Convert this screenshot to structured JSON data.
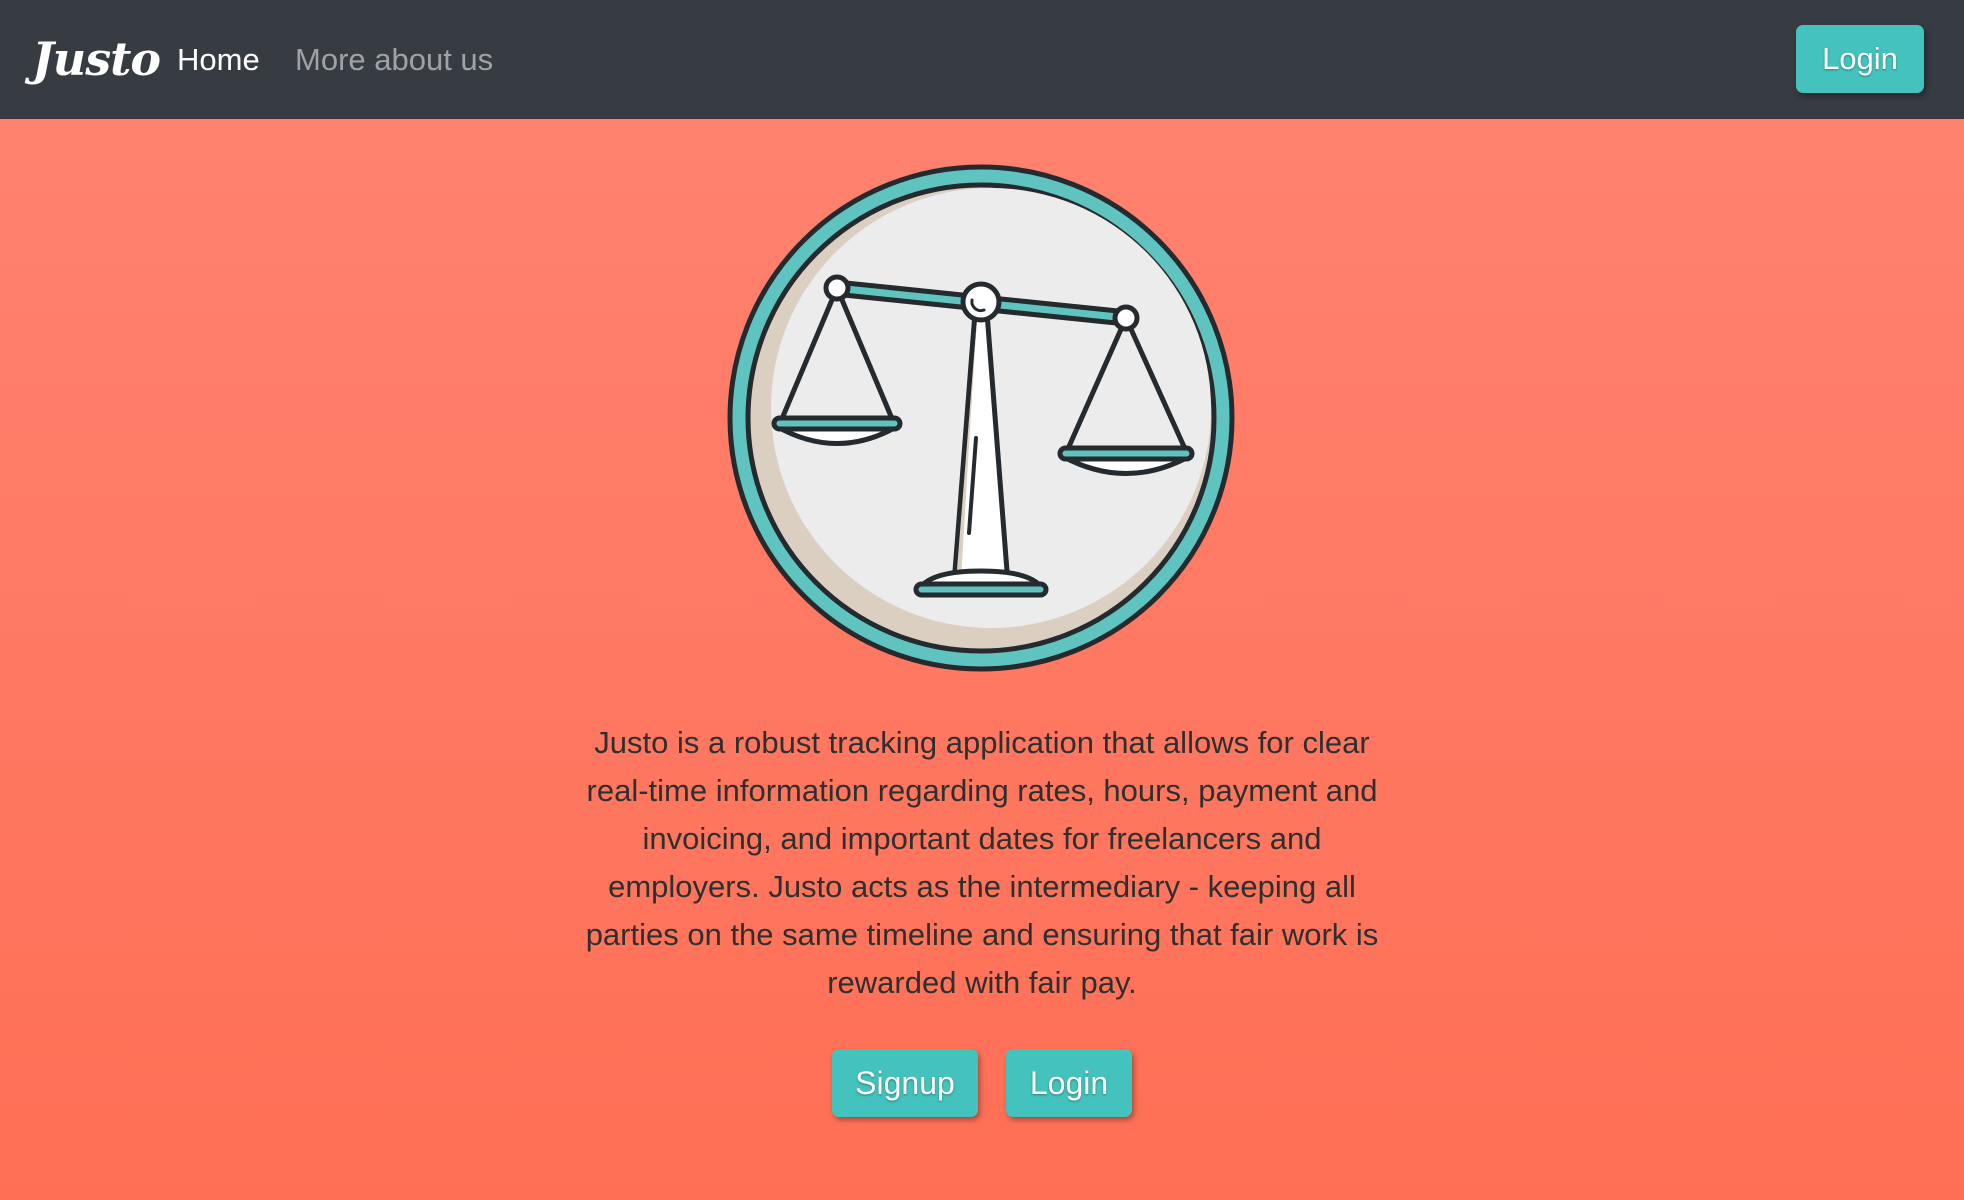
{
  "navbar": {
    "brand": "Justo",
    "links": [
      {
        "label": "Home",
        "active": true
      },
      {
        "label": "More about us",
        "active": false
      }
    ],
    "login_label": "Login"
  },
  "hero": {
    "logo_icon": "scales-of-justice-icon",
    "description": "Justo is a robust tracking application that allows for clear real-time information regarding rates, hours, payment and invoicing, and important dates for freelancers and employers. Justo acts as the intermediary - keeping all parties on the same timeline and ensuring that fair work is rewarded with fair pay.",
    "signup_label": "Signup",
    "login_label": "Login"
  },
  "colors": {
    "navbar_bg": "#373b42",
    "accent_teal": "#44c2bd",
    "background_top": "#ff8472",
    "background_bottom": "#ff6f55"
  }
}
